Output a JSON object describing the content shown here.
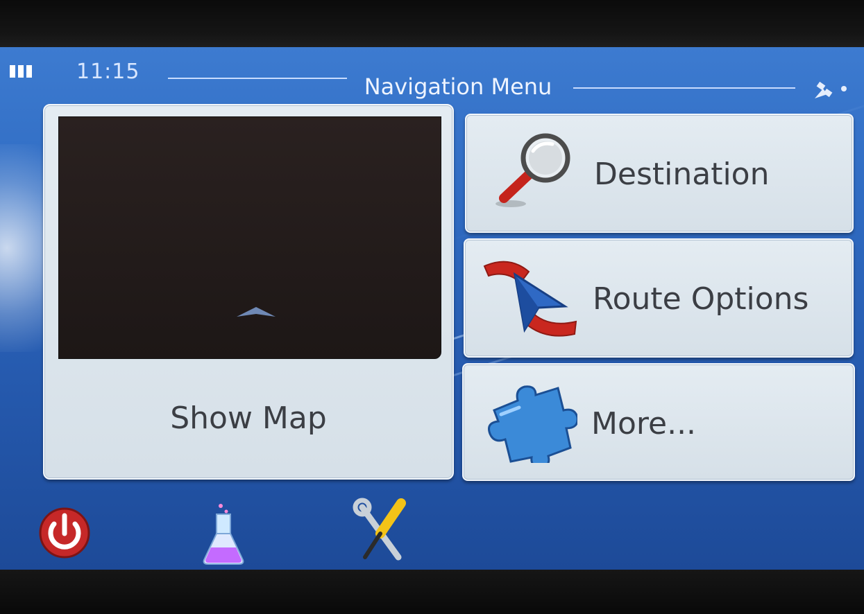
{
  "status_bar": {
    "time": "11:15",
    "title": "Navigation Menu",
    "signal_icon": "signal-bars-icon",
    "gps_icon": "satellite-icon"
  },
  "menu": {
    "show_map": {
      "label": "Show Map",
      "icon": "map-preview"
    },
    "items": [
      {
        "label": "Destination",
        "icon": "magnifier-icon"
      },
      {
        "label": "Route Options",
        "icon": "route-arrow-icon"
      },
      {
        "label": "More...",
        "icon": "puzzle-piece-icon"
      }
    ]
  },
  "bottom_bar": {
    "icons": [
      "power-icon",
      "flask-icon",
      "tools-icon"
    ]
  },
  "colors": {
    "screen_blue": "#2f6bc2",
    "tile_bg": "#dde6ee",
    "text": "#3b3e44",
    "accent_red": "#c9271f",
    "accent_blue": "#2f7fd6"
  }
}
